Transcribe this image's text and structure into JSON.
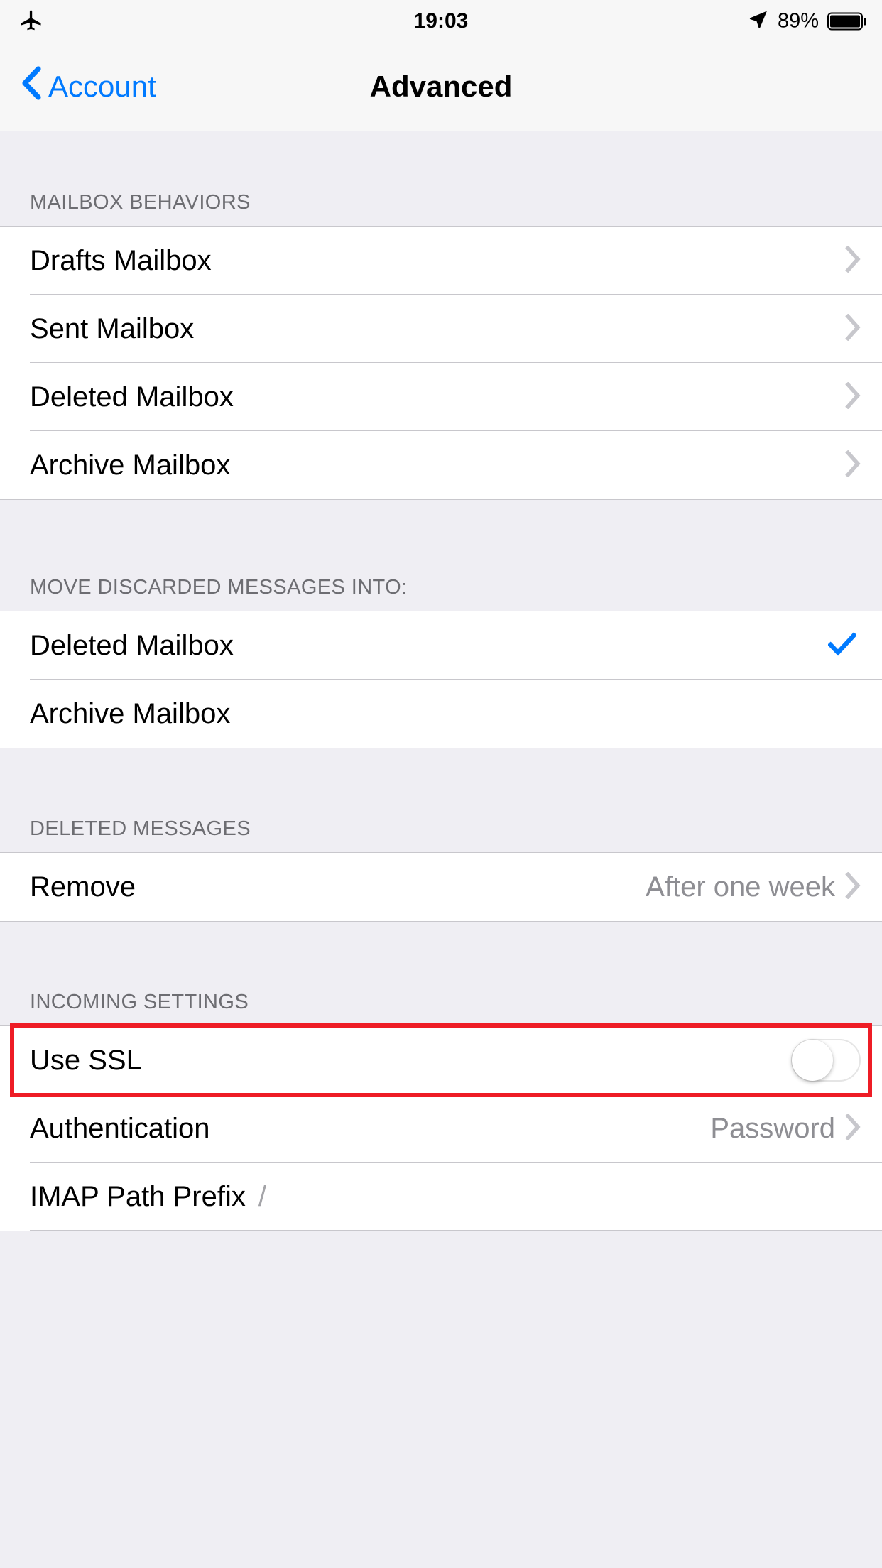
{
  "status_bar": {
    "airplane_icon": "airplane-mode-icon",
    "time": "19:03",
    "location_icon": "location-arrow-icon",
    "battery_percent": "89%",
    "battery_icon": "battery-full-icon"
  },
  "nav_bar": {
    "back_icon": "chevron-left-icon",
    "back_label": "Account",
    "title": "Advanced"
  },
  "sections": [
    {
      "header": "MAILBOX BEHAVIORS",
      "rows": [
        {
          "label": "Drafts Mailbox",
          "accessory": "chevron",
          "value": ""
        },
        {
          "label": "Sent Mailbox",
          "accessory": "chevron",
          "value": ""
        },
        {
          "label": "Deleted Mailbox",
          "accessory": "chevron",
          "value": ""
        },
        {
          "label": "Archive Mailbox",
          "accessory": "chevron",
          "value": ""
        }
      ]
    },
    {
      "header": "MOVE DISCARDED MESSAGES INTO:",
      "rows": [
        {
          "label": "Deleted Mailbox",
          "accessory": "checkmark",
          "value": ""
        },
        {
          "label": "Archive Mailbox",
          "accessory": "none",
          "value": ""
        }
      ]
    },
    {
      "header": "DELETED MESSAGES",
      "rows": [
        {
          "label": "Remove",
          "accessory": "chevron",
          "value": "After one week"
        }
      ]
    },
    {
      "header": "INCOMING SETTINGS",
      "rows": [
        {
          "label": "Use SSL",
          "accessory": "toggle",
          "value": "",
          "toggle_on": false
        },
        {
          "label": "Authentication",
          "accessory": "chevron",
          "value": "Password"
        },
        {
          "label": "IMAP Path Prefix",
          "accessory": "none",
          "value": "/"
        }
      ]
    }
  ],
  "annotation": {
    "type": "red-highlight-rectangle",
    "target": "Use SSL"
  },
  "colors": {
    "accent_blue": "#007AFF",
    "annotation_red": "#EE1C25",
    "group_background": "#EFEEF3",
    "row_background": "#FFFFFF",
    "separator": "#C8C7CC",
    "secondary_text": "#8E8E93",
    "header_text": "#6D6D72"
  }
}
